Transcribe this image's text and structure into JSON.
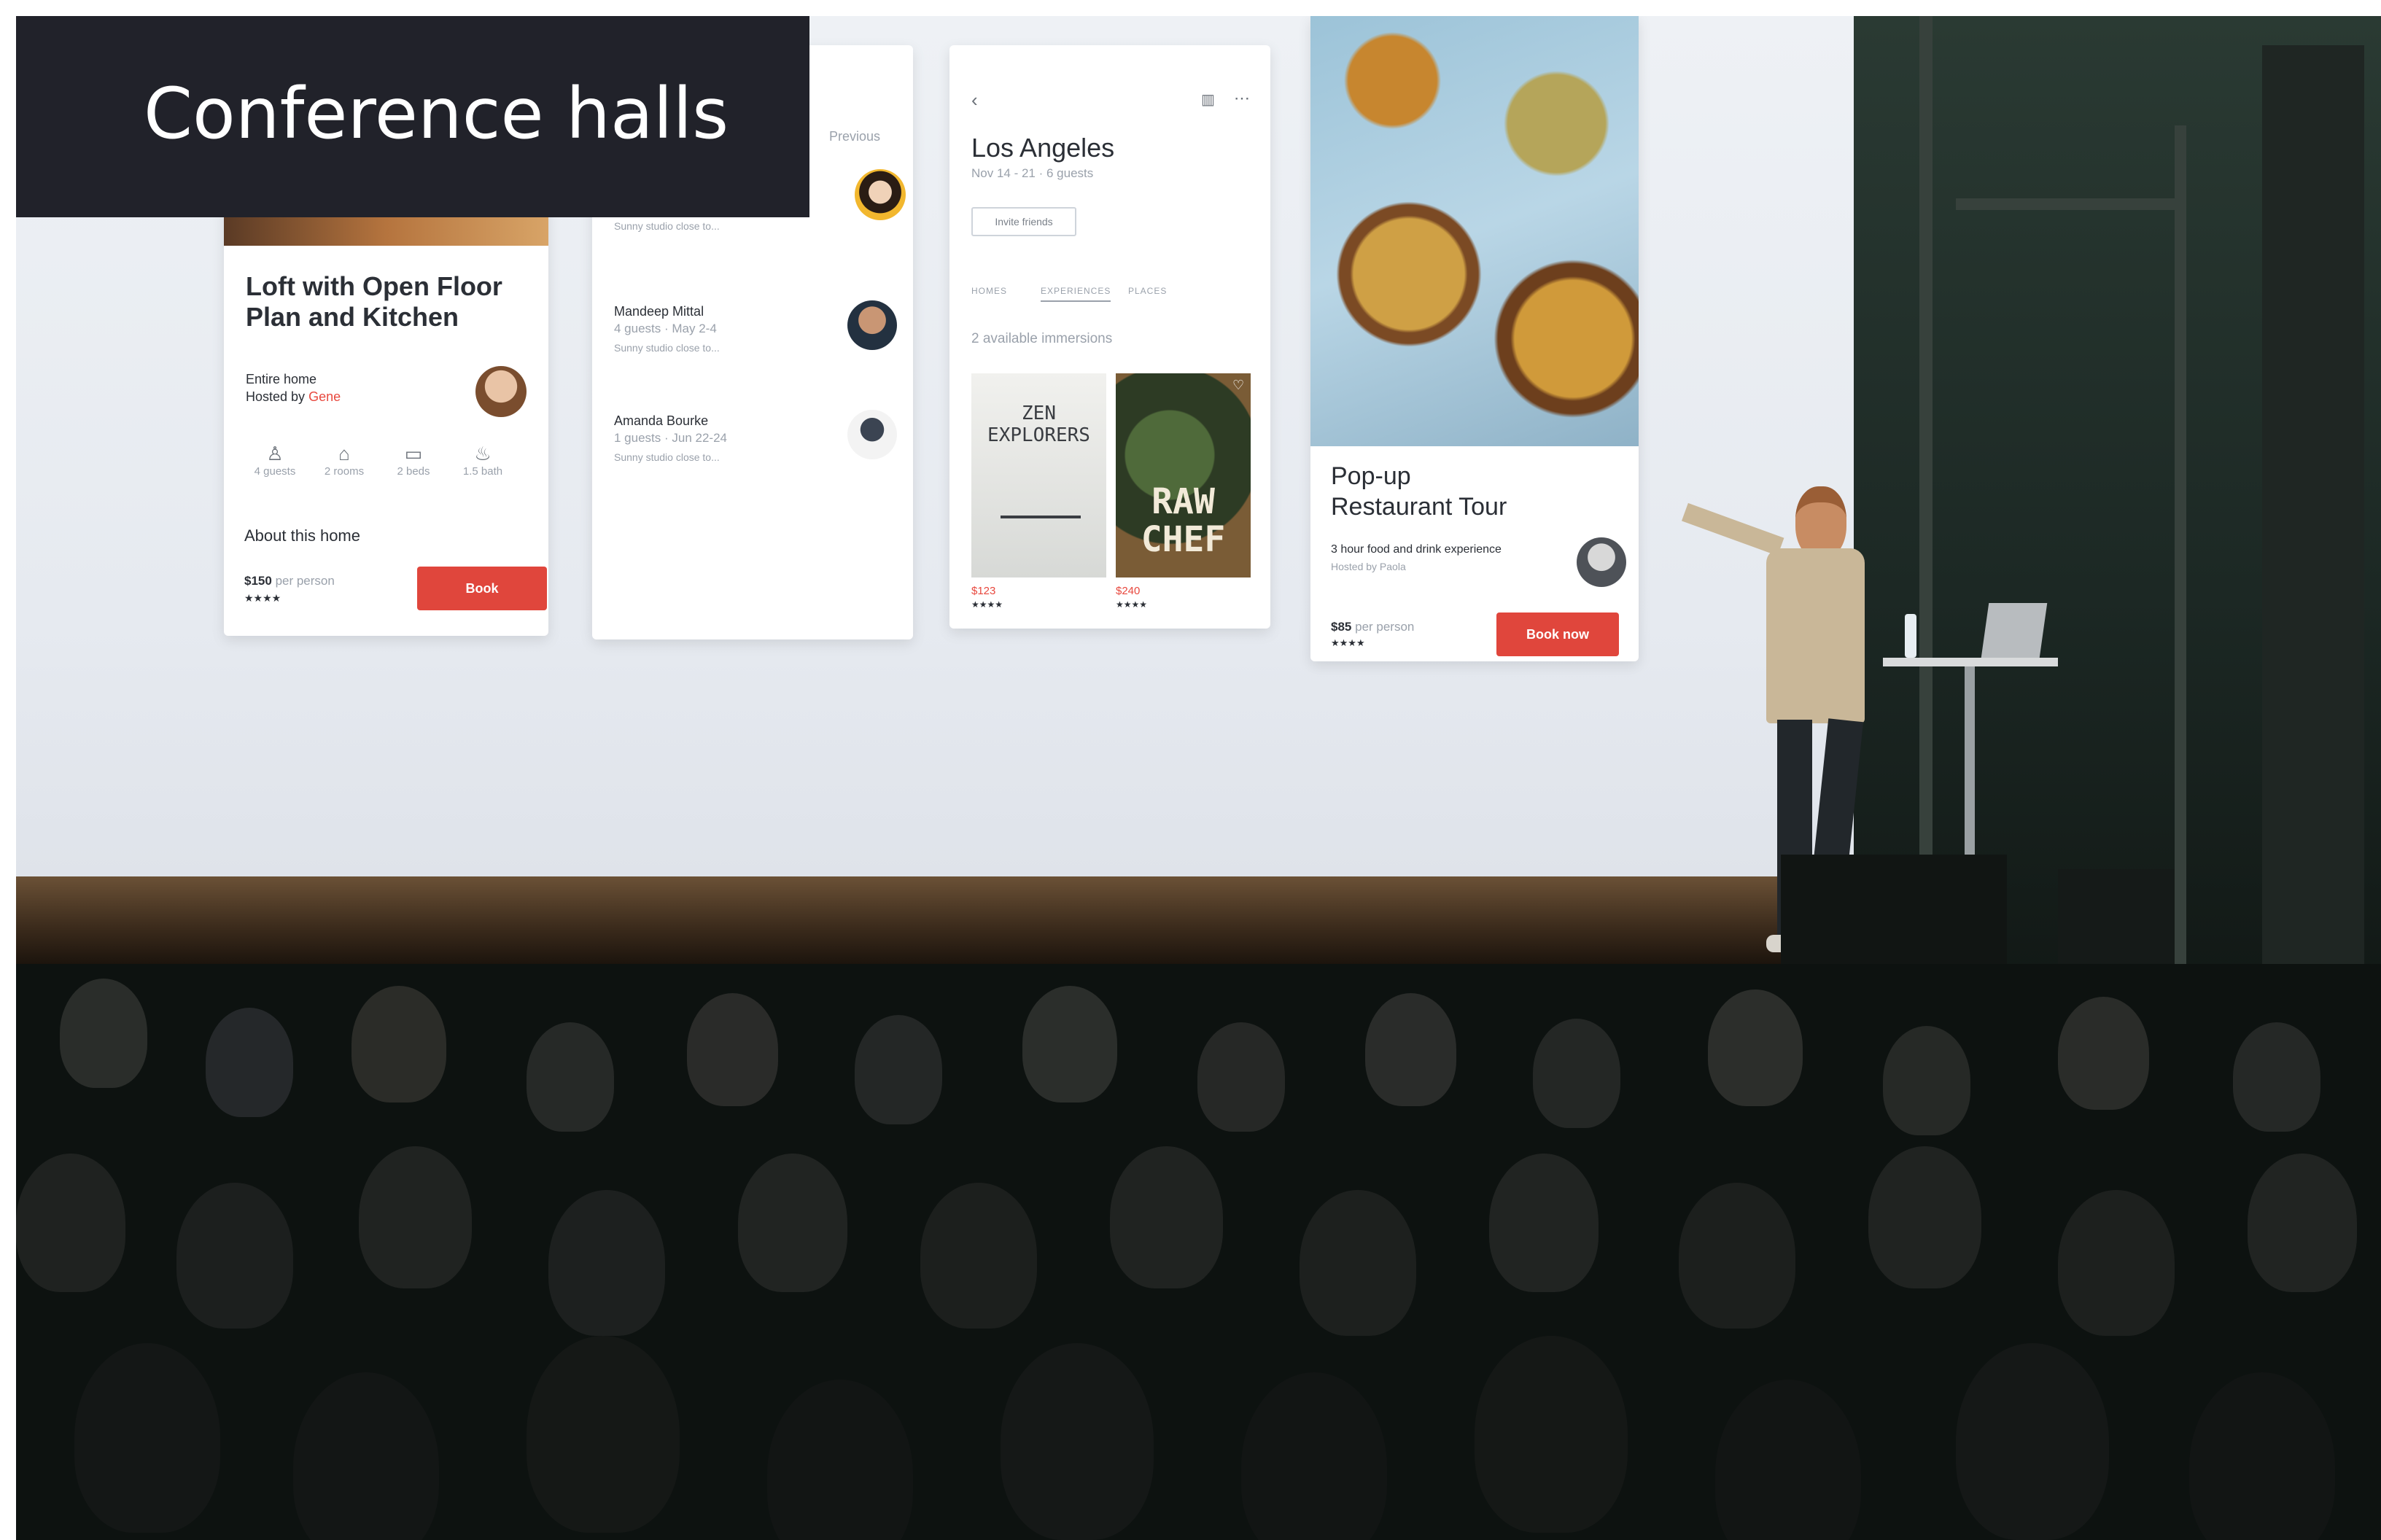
{
  "overlay": {
    "title": "Conference halls"
  },
  "card_loft": {
    "title": "Loft with Open Floor Plan and Kitchen",
    "type": "Entire home",
    "hosted_by": "Hosted by",
    "host": "Gene",
    "amenities": [
      "4 guests",
      "2 rooms",
      "2 beds",
      "1.5 bath"
    ],
    "about": "About this home",
    "price": "$150",
    "price_unit": "per person",
    "book": "Book"
  },
  "card_messages": {
    "header": "Previous",
    "items": [
      {
        "name": "Mandeep Mittal",
        "meta": "4 guests · May 2-4",
        "snippet": "Sunny studio close to..."
      },
      {
        "name": "Amanda Bourke",
        "meta": "1 guests · Jun 22-24",
        "snippet": "Sunny studio close to..."
      }
    ]
  },
  "card_la": {
    "title": "Los Angeles",
    "subtitle": "Nov 14 - 21 · 6 guests",
    "invite": "Invite friends",
    "tabs": [
      "HOMES",
      "EXPERIENCES",
      "PLACES"
    ],
    "available": "2 available immersions",
    "book1": {
      "title_line1": "ZEN",
      "title_line2": "EXPLORERS",
      "price": "$123"
    },
    "book2": {
      "title_line1": "RAW",
      "title_line2": "CHEF",
      "price": "$240"
    }
  },
  "card_popup": {
    "title_line1": "Pop-up",
    "title_line2": "Restaurant Tour",
    "desc": "3 hour food and drink experience",
    "hosted": "Hosted by Paola",
    "price": "$85",
    "price_unit": "per person",
    "book": "Book now"
  },
  "colors": {
    "accent": "#e0463c",
    "overlay_bg": "#21222a"
  }
}
